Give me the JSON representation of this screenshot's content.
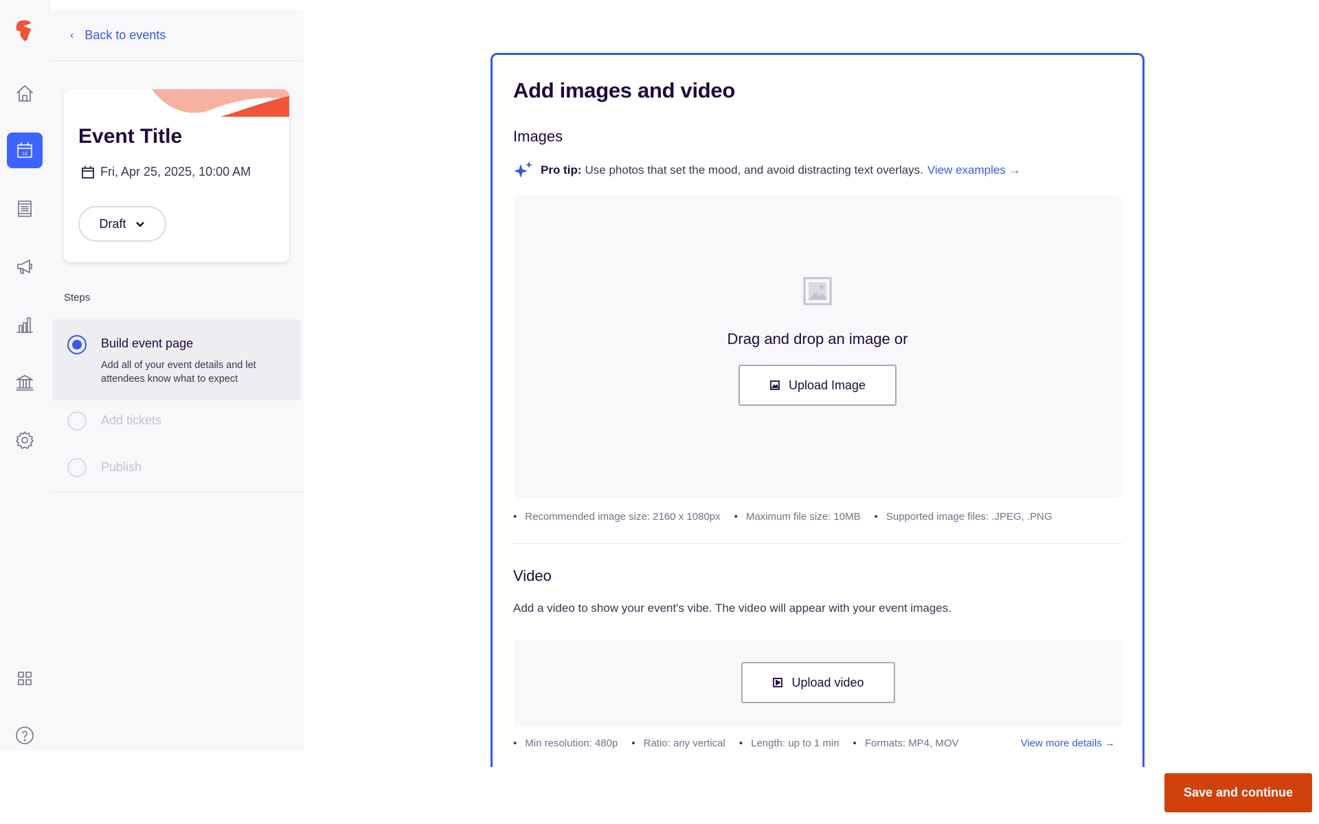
{
  "nav": {
    "items": [
      {
        "icon": "home-icon",
        "label": "Home"
      },
      {
        "icon": "calendar-icon",
        "label": "Events",
        "active": true
      },
      {
        "icon": "orders-icon",
        "label": "Orders"
      },
      {
        "icon": "megaphone-icon",
        "label": "Marketing"
      },
      {
        "icon": "chart-icon",
        "label": "Reporting"
      },
      {
        "icon": "bank-icon",
        "label": "Finance"
      },
      {
        "icon": "gear-icon",
        "label": "Settings"
      },
      {
        "icon": "apps-icon",
        "label": "App Marketplace"
      },
      {
        "icon": "help-icon",
        "label": "Help"
      }
    ],
    "calendar_day": "16"
  },
  "sidebar": {
    "back_label": "Back to events",
    "event": {
      "title": "Event Title",
      "date": "Fri, Apr 25, 2025, 10:00 AM",
      "status": "Draft"
    },
    "steps_heading": "Steps",
    "steps": [
      {
        "title": "Build event page",
        "description": "Add all of your event details and let attendees know what to expect",
        "state": "active"
      },
      {
        "title": "Add tickets",
        "state": "disabled"
      },
      {
        "title": "Publish",
        "state": "disabled"
      }
    ]
  },
  "main": {
    "heading": "Add images and video",
    "images": {
      "heading": "Images",
      "tip_label": "Pro tip:",
      "tip_text": "Use photos that set the mood, and avoid distracting text overlays.",
      "tip_link": "View examples",
      "dropzone_text": "Drag and drop an image or",
      "upload_label": "Upload Image",
      "requirements": [
        "Recommended image size: 2160 x 1080px",
        "Maximum file size: 10MB",
        "Supported image files: .JPEG, .PNG"
      ]
    },
    "video": {
      "heading": "Video",
      "description": "Add a video to show your event's vibe. The video will appear with your event images.",
      "upload_label": "Upload video",
      "requirements": [
        "Min resolution: 480p",
        "Ratio: any vertical",
        "Length: up to 1 min",
        "Formats: MP4, MOV"
      ],
      "details_link": "View more details"
    }
  },
  "footer": {
    "save_label": "Save and continue"
  },
  "colors": {
    "accent": "#3659e3",
    "brand": "#f05537",
    "primary_button": "#d1410c"
  }
}
